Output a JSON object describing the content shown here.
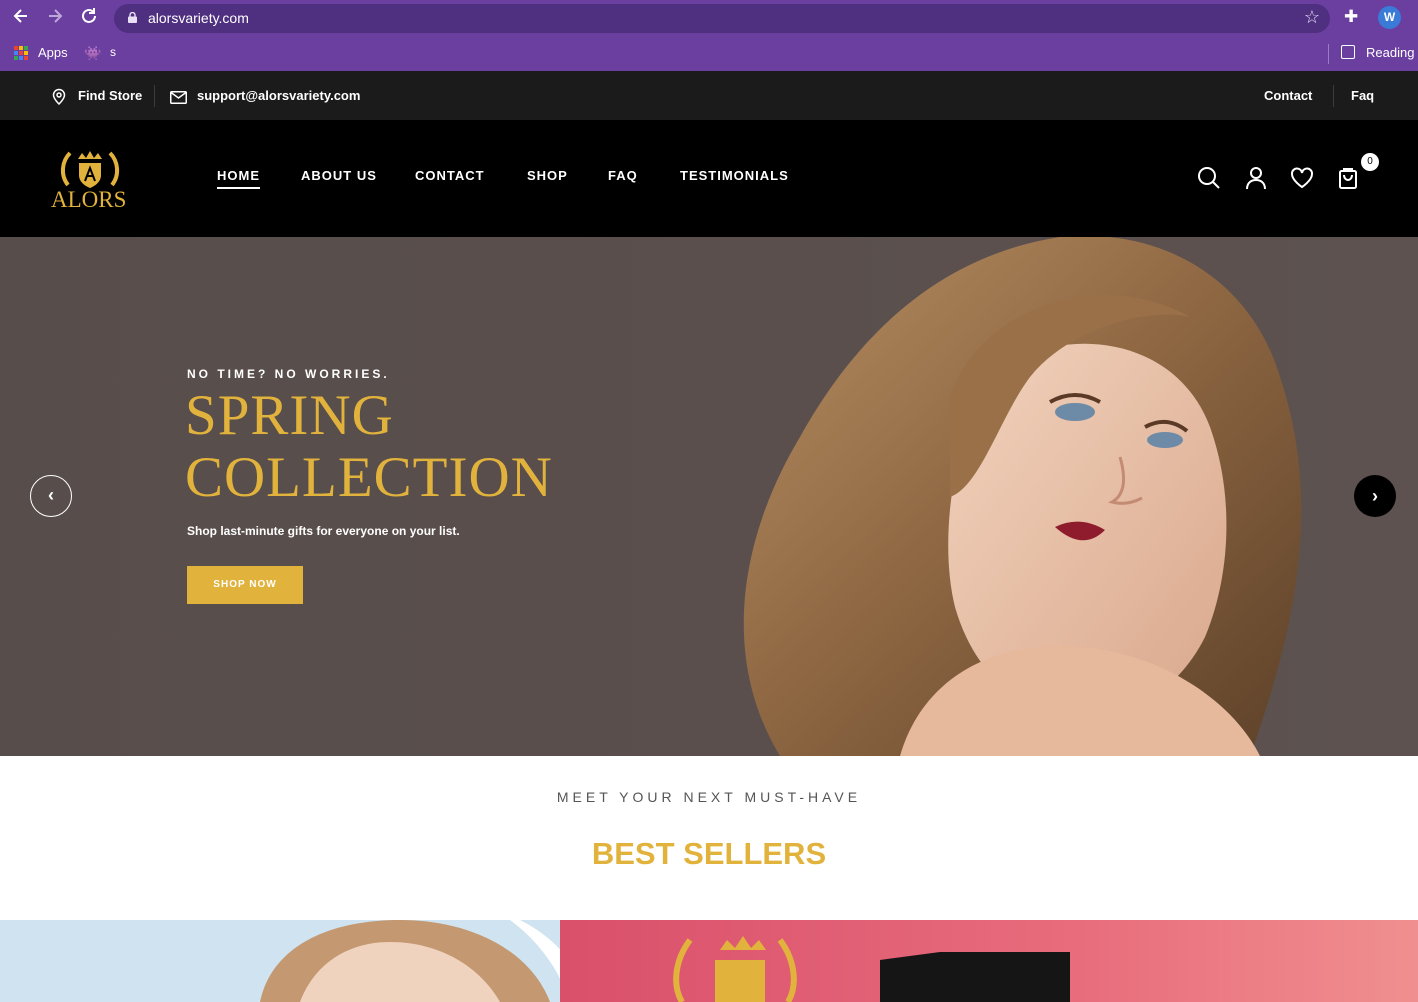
{
  "browser": {
    "url": "alorsvariety.com",
    "profile_initial": "W",
    "bookmarks": {
      "apps_label": "Apps",
      "s_label": "s",
      "reading_list_label": "Reading l"
    }
  },
  "topbar": {
    "find_store": "Find Store",
    "email": "support@alorsvariety.com",
    "contact": "Contact",
    "faq": "Faq"
  },
  "header": {
    "logo_text": "ALORS",
    "nav": [
      {
        "label": "HOME"
      },
      {
        "label": "ABOUT US"
      },
      {
        "label": "CONTACT"
      },
      {
        "label": "SHOP"
      },
      {
        "label": "FAQ"
      },
      {
        "label": "TESTIMONIALS"
      }
    ],
    "active_nav": "HOME",
    "cart_count": "0"
  },
  "hero": {
    "eyebrow": "NO TIME? NO WORRIES.",
    "title_line1": "SPRING",
    "title_line2": "COLLECTION",
    "subtitle": "Shop last-minute gifts for everyone on your list.",
    "button_label": "SHOP NOW",
    "prev_arrow": "‹",
    "next_arrow": "›"
  },
  "best_sellers": {
    "eyebrow": "MEET YOUR NEXT MUST-HAVE",
    "title": "BEST SELLERS"
  },
  "colors": {
    "browser_purple": "#6b3fa0",
    "gold_accent": "#e2b33c",
    "header_black": "#000000",
    "topbar_dark": "#1b1b1b",
    "hero_bg": "#574d4b"
  }
}
